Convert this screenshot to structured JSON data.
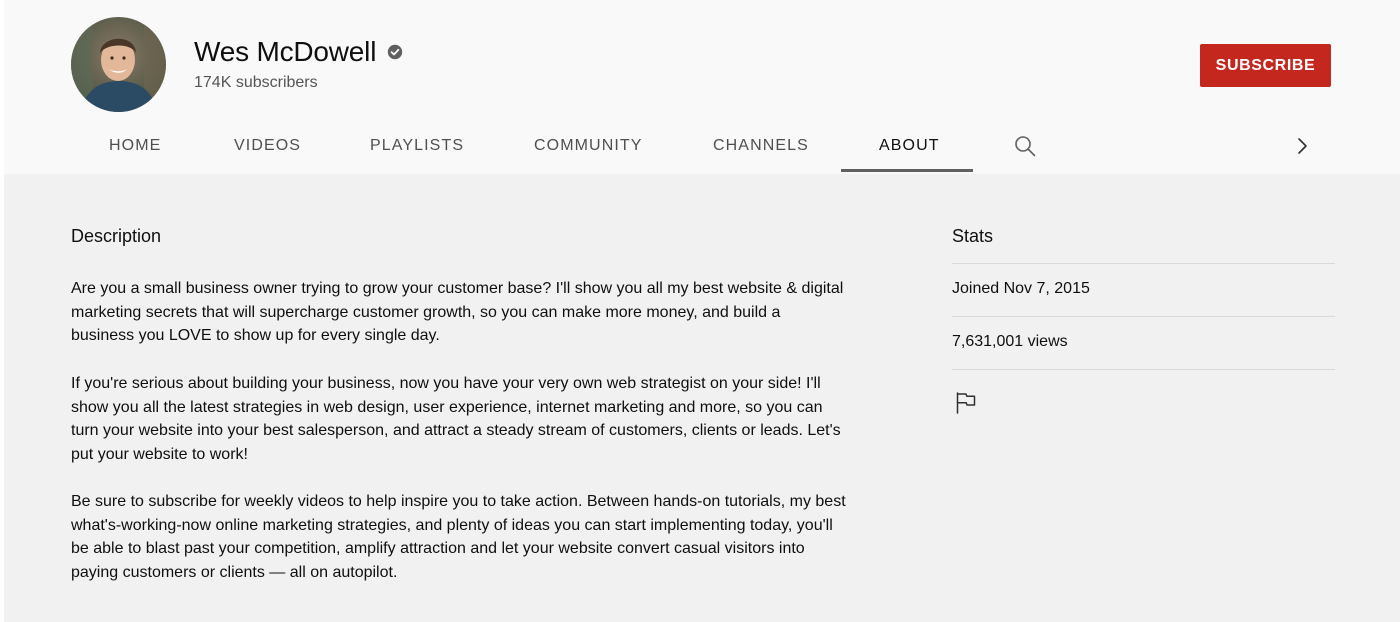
{
  "channel": {
    "name": "Wes McDowell",
    "subscribers": "174K subscribers",
    "verified_icon": "verified-check-icon",
    "subscribe_label": "SUBSCRIBE",
    "accent_color": "#c4271d"
  },
  "tabs": [
    {
      "label": "HOME"
    },
    {
      "label": "VIDEOS"
    },
    {
      "label": "PLAYLISTS"
    },
    {
      "label": "COMMUNITY"
    },
    {
      "label": "CHANNELS"
    },
    {
      "label": "ABOUT",
      "active": true
    }
  ],
  "tab_icons": [
    "search-icon",
    "chevron-right-icon"
  ],
  "about": {
    "description_title": "Description",
    "paragraphs": [
      "Are you a small business owner trying to grow your customer base? I'll show you all my best website & digital marketing secrets that will supercharge customer growth, so you can make more money, and build a business you LOVE to show up for every single day.",
      "If you're serious about building your business, now you have your very own web strategist on your side! I'll show you all the latest strategies in web design, user experience, internet marketing and more, so you can turn your website into your best salesperson, and attract a steady stream of customers, clients or leads. Let's put your website to work!",
      "Be sure to subscribe for weekly videos to help inspire you to take action. Between hands-on tutorials, my best what's-working-now online marketing strategies, and plenty of ideas you can start implementing today, you'll be able to blast past your competition, amplify attraction and let your website convert casual visitors into paying customers or clients — all on autopilot."
    ],
    "stats_title": "Stats",
    "joined": "Joined Nov 7, 2015",
    "views": "7,631,001 views",
    "report_icon": "flag-icon"
  }
}
